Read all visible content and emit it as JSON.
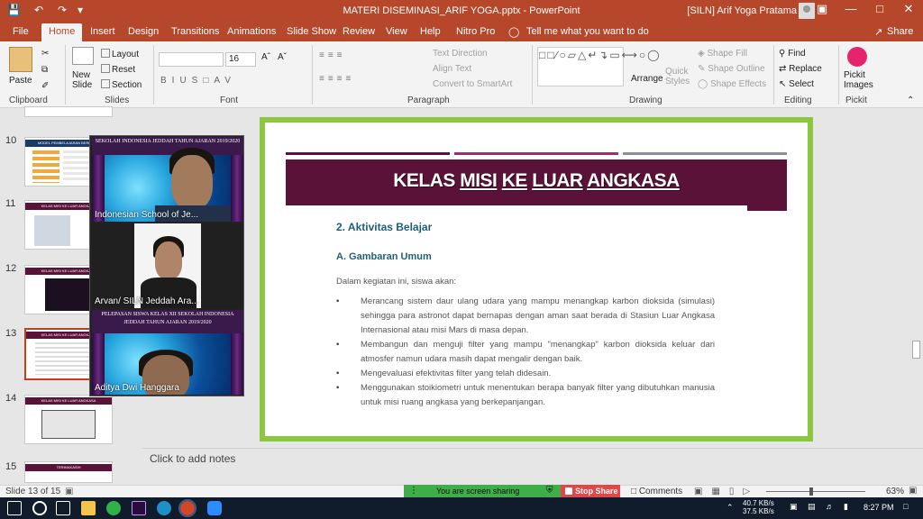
{
  "window": {
    "title": "MATERI DISEMINASI_ARIF YOGA.pptx  -  PowerPoint",
    "user": "[SILN] Arif Yoga Pratama",
    "accent": "#b7472a"
  },
  "tabs": [
    "File",
    "Home",
    "Insert",
    "Design",
    "Transitions",
    "Animations",
    "Slide Show",
    "Review",
    "View",
    "Help",
    "Nitro Pro",
    "Tell me what you want to do",
    "Share"
  ],
  "ribbon": {
    "clipboard": {
      "paste": "Paste",
      "label": "Clipboard"
    },
    "slides": {
      "new_slide": "New Slide",
      "layout": "Layout",
      "reset": "Reset",
      "section": "Section",
      "label": "Slides"
    },
    "font": {
      "font_name": "",
      "font_size": "16",
      "label": "Font"
    },
    "paragraph": {
      "text_direction": "Text Direction",
      "align_text": "Align Text",
      "convert_smartart": "Convert to SmartArt",
      "label": "Paragraph"
    },
    "drawing": {
      "arrange": "Arrange",
      "quick_styles": "Quick Styles",
      "shape_fill": "Shape Fill",
      "shape_outline": "Shape Outline",
      "shape_effects": "Shape Effects",
      "label": "Drawing"
    },
    "editing": {
      "find": "Find",
      "replace": "Replace",
      "select": "Select",
      "label": "Editing"
    },
    "pickit": {
      "label": "Pickit Images",
      "group": "Pickit"
    }
  },
  "thumbnails": [
    {
      "num": "10",
      "title": "MODEL PEMBELAJARAN BERBASIS"
    },
    {
      "num": "11",
      "title": "KELAS MISI KE LUAR ANGKASA"
    },
    {
      "num": "12",
      "title": "KELAS MISI KE LUAR ANGKASA"
    },
    {
      "num": "13",
      "title": "KELAS MISI KE LUAR ANGKASA"
    },
    {
      "num": "14",
      "title": "KELAS MISI KE LUAR ANGKASA"
    },
    {
      "num": "15",
      "title": "TERIMAKASIH"
    }
  ],
  "video": {
    "participants": [
      {
        "name": "Indonesian School of Je...",
        "banner": "SEKOLAH INDONESIA JEDDAH TAHUN AJARAN 2019/2020"
      },
      {
        "name": "Arvan/ SILN Jeddah Ara...",
        "banner": ""
      },
      {
        "name": "Aditya Dwi Hanggara",
        "banner": "PELEPASAN SISWA KELAS XII SEKOLAH INDONESIA JEDDAH TAHUN AJARAN 2019/2020"
      }
    ]
  },
  "slide": {
    "title_parts": [
      "KELAS ",
      "MISI",
      " ",
      "KE",
      " ",
      "LUAR",
      " ",
      "ANGKASA"
    ],
    "section_heading": "2.  Aktivitas Belajar",
    "sub_heading": "A.   Gambaran Umum",
    "intro": "Dalam kegiatan ini, siswa akan:",
    "bullets": [
      "Merancang sistem daur ulang udara yang mampu menangkap karbon dioksida (simulasi) sehingga para astronot dapat bernapas dengan aman saat berada di Stasiun Luar Angkasa Internasional atau misi Mars di masa depan.",
      "Membangun dan menguji filter yang mampu \"menangkap\" karbon dioksida keluar dari atmosfer namun udara masih dapat mengalir dengan baik.",
      "Mengevaluasi efektivitas filter yang telah didesain.",
      "Menggunakan stoikiometri untuk menentukan berapa banyak filter yang dibutuhkan manusia untuk misi ruang angkasa yang berkepanjangan."
    ],
    "header_color": "#5a1238",
    "frame_color": "#8dc63f"
  },
  "notes_placeholder": "Click to add notes",
  "status": {
    "slide_count": "Slide 13 of 15",
    "sharing": "You are screen sharing",
    "stop_share": "Stop Share",
    "comments": "Comments",
    "zoom": "63%"
  },
  "taskbar": {
    "net_up": "40.7 KB/s",
    "net_down": "37.5 KB/s",
    "time": "8:27 PM"
  }
}
